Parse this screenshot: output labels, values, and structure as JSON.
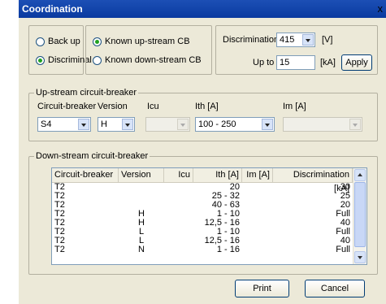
{
  "window": {
    "title": "Coordination",
    "close_glyph": "x"
  },
  "mode": {
    "options": [
      {
        "label": "Back up",
        "selected": false
      },
      {
        "label": "Discriminal",
        "selected": true
      }
    ]
  },
  "known": {
    "options": [
      {
        "label": "Known up-stream CB",
        "selected": true
      },
      {
        "label": "Known down-stream CB",
        "selected": false
      }
    ]
  },
  "discrimination": {
    "label": "Discrimination",
    "voltage": "415",
    "voltage_unit": "[V]",
    "upto_label": "Up to",
    "upto_value": "15",
    "upto_unit": "[kA]",
    "apply_label": "Apply"
  },
  "upstream": {
    "legend": "Up-stream circuit-breaker",
    "labels": {
      "circuit_breaker": "Circuit-breaker",
      "version": "Version",
      "icu": "Icu",
      "ith": "Ith [A]",
      "im": "Im [A]"
    },
    "values": {
      "circuit_breaker": "S4",
      "version": "H",
      "icu": "",
      "ith": "100 - 250",
      "im": ""
    }
  },
  "downstream": {
    "legend": "Down-stream circuit-breaker",
    "columns": [
      "Circuit-breaker",
      "Version",
      "Icu",
      "Ith [A]",
      "Im [A]",
      "Discrimination [kA]"
    ],
    "rows": [
      [
        "T2",
        "",
        "",
        "20",
        "",
        "30"
      ],
      [
        "T2",
        "",
        "",
        "25 - 32",
        "",
        "25"
      ],
      [
        "T2",
        "",
        "",
        "40 - 63",
        "",
        "20"
      ],
      [
        "T2",
        "H",
        "",
        "1 - 10",
        "",
        "Full"
      ],
      [
        "T2",
        "H",
        "",
        "12,5 - 16",
        "",
        "40"
      ],
      [
        "T2",
        "L",
        "",
        "1 - 10",
        "",
        "Full"
      ],
      [
        "T2",
        "L",
        "",
        "12,5 - 16",
        "",
        "40"
      ],
      [
        "T2",
        "N",
        "",
        "1 - 16",
        "",
        "Full"
      ]
    ]
  },
  "footer": {
    "print_label": "Print",
    "cancel_label": "Cancel"
  },
  "colors": {
    "titlebar": "#0a3aa0",
    "dialog": "#ece9d8",
    "radio_dot": "#21a121"
  },
  "icons": {
    "close": "close-icon",
    "dropdown": "chevron-down-icon"
  }
}
